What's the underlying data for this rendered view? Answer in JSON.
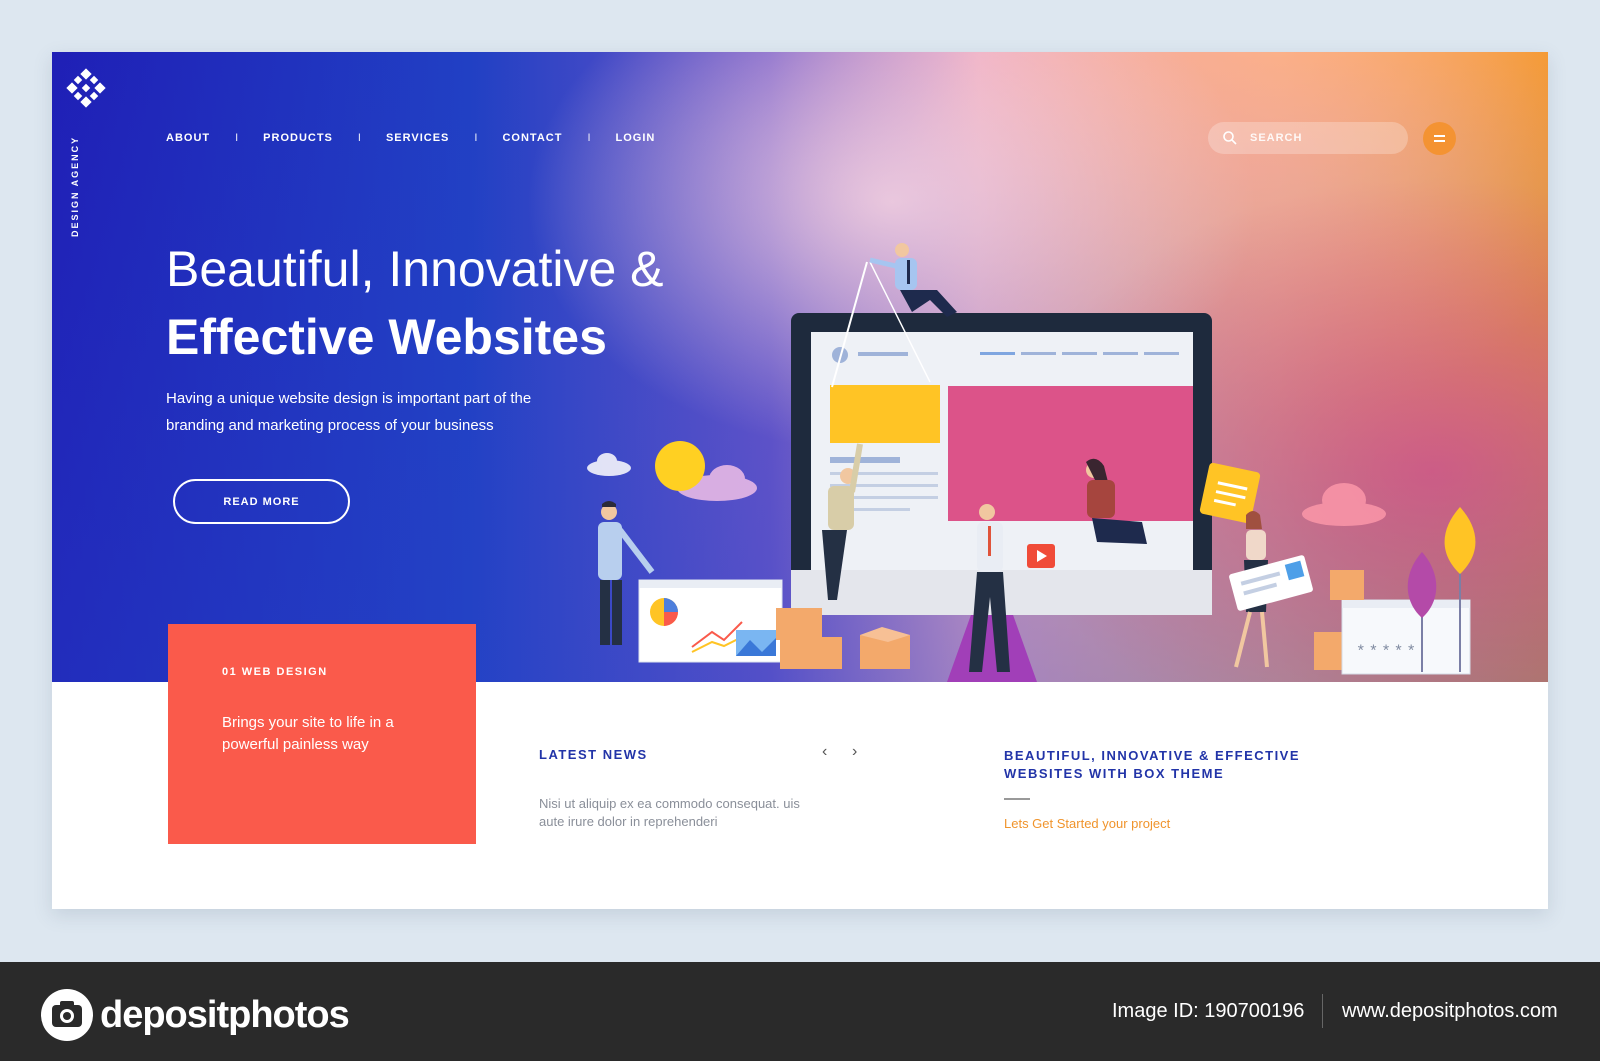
{
  "brand": {
    "vertical_label": "DESIGN AGENCY"
  },
  "nav": {
    "items": [
      "ABOUT",
      "PRODUCTS",
      "SERVICES",
      "CONTACT",
      "LOGIN"
    ],
    "separator": "I"
  },
  "search": {
    "placeholder": "SEARCH"
  },
  "hero": {
    "headline_line1": "Beautiful, Innovative &",
    "headline_line2": "Effective Websites",
    "subtext": "Having a unique website design is important part of the branding and marketing process of your business",
    "cta": "READ MORE"
  },
  "card": {
    "tag": "01  WEB DESIGN",
    "description": "Brings your site to life in a powerful painless way"
  },
  "news": {
    "title": "LATEST NEWS",
    "prev": "‹",
    "next": "›",
    "body": "Nisi ut aliquip ex ea commodo consequat. uis aute irure dolor in reprehenderi"
  },
  "theme": {
    "title": "BEAUTIFUL, INNOVATIVE & EFFECTIVE WEBSITES WITH BOX THEME",
    "link": "Lets Get Started your project"
  },
  "illustration": {
    "password_mask": "*****"
  },
  "footer": {
    "brand": "depositphotos",
    "image_id": "Image ID: 190700196",
    "site": "www.depositphotos.com"
  },
  "colors": {
    "accent_orange": "#f49332",
    "card_red": "#fa5a4b",
    "title_blue": "#2234a8",
    "link_orange": "#f0942c"
  }
}
